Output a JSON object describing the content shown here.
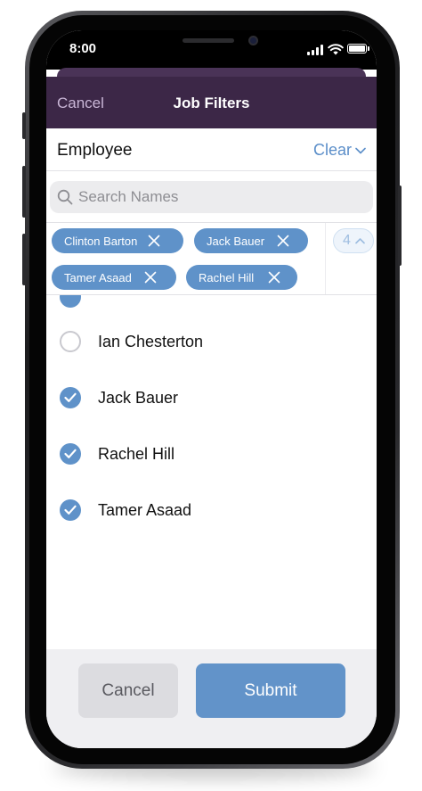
{
  "status_bar": {
    "time": "8:00",
    "icons": [
      "signal-icon",
      "wifi-icon",
      "battery-icon"
    ]
  },
  "nav": {
    "cancel_label": "Cancel",
    "title": "Job Filters"
  },
  "filter": {
    "label": "Employee",
    "clear_label": "Clear"
  },
  "search": {
    "placeholder": "Search Names",
    "value": ""
  },
  "chips": [
    {
      "label": "Clinton Barton"
    },
    {
      "label": "Jack Bauer"
    },
    {
      "label": "Tamer Asaad"
    },
    {
      "label": "Rachel Hill"
    }
  ],
  "selected_count": "4",
  "employees": [
    {
      "name": "Ian Chesterton",
      "checked": false
    },
    {
      "name": "Jack Bauer",
      "checked": true
    },
    {
      "name": "Rachel Hill",
      "checked": true
    },
    {
      "name": "Tamer Asaad",
      "checked": true
    }
  ],
  "footer": {
    "cancel_label": "Cancel",
    "submit_label": "Submit"
  },
  "colors": {
    "header": "#3c2747",
    "accent": "#5f92c9",
    "submit": "#6293c9"
  }
}
